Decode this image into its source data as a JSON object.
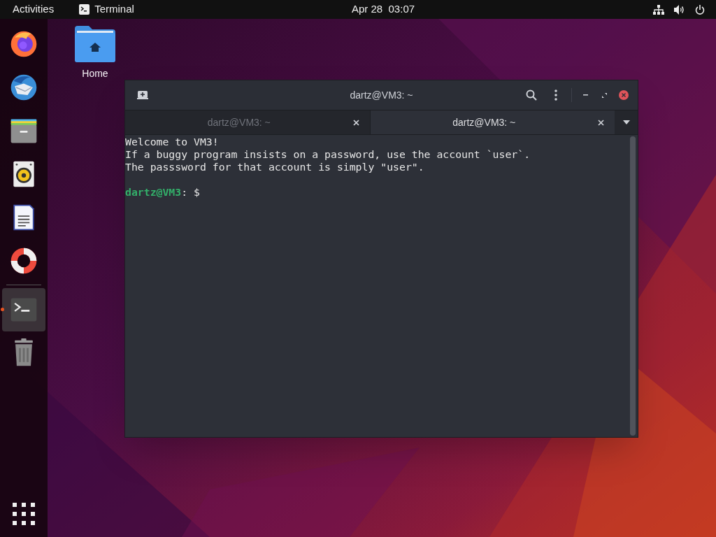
{
  "top_bar": {
    "activities": "Activities",
    "app_label": "Terminal",
    "clock": "Apr 28  03:07"
  },
  "dock": {
    "items": [
      {
        "kind": "firefox",
        "running": false
      },
      {
        "kind": "thunderbird",
        "running": false
      },
      {
        "kind": "files",
        "running": false
      },
      {
        "kind": "rhythmbox",
        "running": false
      },
      {
        "kind": "writer",
        "running": false
      },
      {
        "kind": "help",
        "running": false
      },
      {
        "kind": "terminal",
        "running": true
      },
      {
        "kind": "trash",
        "running": false
      }
    ]
  },
  "desktop_icons": [
    {
      "label": "Home"
    }
  ],
  "window": {
    "title": "dartz@VM3: ~",
    "tabs": [
      {
        "label": "dartz@VM3: ~",
        "selected": false
      },
      {
        "label": "dartz@VM3: ~",
        "selected": true
      }
    ],
    "output": [
      "Welcome to VM3!",
      "If a buggy program insists on a password, use the account `user`.",
      "The passsword for that account is simply \"user\"."
    ],
    "prompt": {
      "user_host": "dartz@VM3",
      "rest": ": $"
    }
  }
}
